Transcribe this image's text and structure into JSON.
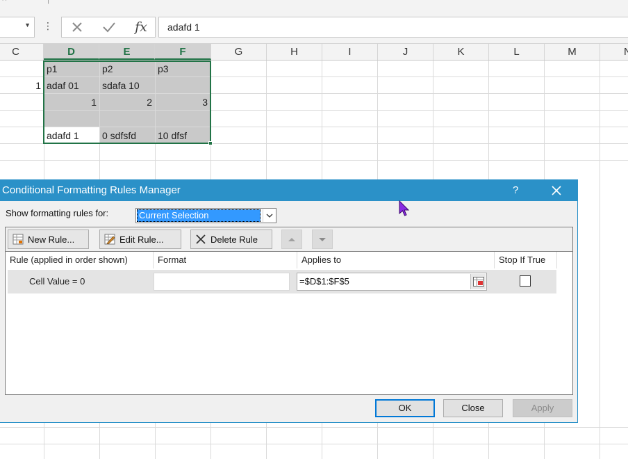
{
  "formula_bar": {
    "name_box": "",
    "cancel_icon": "x-icon",
    "enter_icon": "check-icon",
    "function_label": "fx",
    "formula_value": "adafd 1"
  },
  "grid": {
    "columns": [
      "C",
      "D",
      "E",
      "F",
      "G",
      "H",
      "I",
      "J",
      "K",
      "L",
      "M",
      "N"
    ],
    "selected_columns": [
      "D",
      "E",
      "F"
    ],
    "cells": {
      "d1": "p1",
      "e1": "p2",
      "f1": "p3",
      "c2": "1",
      "d2": "adaf 01",
      "e2": "sdafa 10",
      "d3": "1",
      "e3": "2",
      "f3": "3",
      "d5": "adafd 1",
      "e5": "0 sdfsfd",
      "f5": "10 dfsf"
    }
  },
  "dialog": {
    "title": "Conditional Formatting Rules Manager",
    "help": "?",
    "show_label": "Show formatting rules for:",
    "show_value": "Current Selection",
    "buttons": {
      "new_rule": "New Rule...",
      "edit_rule": "Edit Rule...",
      "delete_rule": "Delete Rule"
    },
    "columns": {
      "rule": "Rule (applied in order shown)",
      "format": "Format",
      "applies_to": "Applies to",
      "stop_if_true": "Stop If True"
    },
    "rules": [
      {
        "rule": "Cell Value = 0",
        "format": "",
        "applies_to": "=$D$1:$F$5",
        "stop_if_true": false
      }
    ],
    "footer": {
      "ok": "OK",
      "close": "Close",
      "apply": "Apply"
    }
  },
  "colors": {
    "title_bar": "#2b91c8",
    "selection_border": "#217346",
    "selected_header_text": "#217346",
    "cursor": "#8a2be2"
  }
}
